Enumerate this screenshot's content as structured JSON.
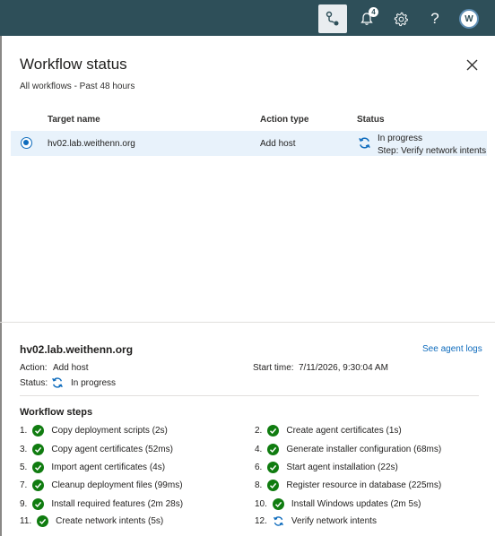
{
  "topbar": {
    "notification_count": "4",
    "avatar_initial": "W",
    "icons": [
      "workflow-icon",
      "bell-icon",
      "gear-icon",
      "help-icon",
      "avatar"
    ],
    "color": "#2e4f59"
  },
  "panel": {
    "title": "Workflow status",
    "subtitle": "All workflows - Past 48 hours"
  },
  "table": {
    "headers": {
      "target": "Target name",
      "action": "Action type",
      "status": "Status"
    },
    "rows": [
      {
        "target": "hv02.lab.weithenn.org",
        "action": "Add host",
        "status": "In progress",
        "step": "Step: Verify network intents",
        "selected": true
      }
    ]
  },
  "detail": {
    "host": "hv02.lab.weithenn.org",
    "see_logs": "See agent logs",
    "action_label": "Action:",
    "action_value": "Add host",
    "start_label": "Start time:",
    "start_value": "7/11/2026, 9:30:04 AM",
    "status_label": "Status:",
    "status_value": "In progress"
  },
  "steps": {
    "title": "Workflow steps",
    "items": [
      {
        "num": "1.",
        "label": "Copy deployment scripts (2s)",
        "state": "done"
      },
      {
        "num": "2.",
        "label": "Create agent certificates (1s)",
        "state": "done"
      },
      {
        "num": "3.",
        "label": "Copy agent certificates (52ms)",
        "state": "done"
      },
      {
        "num": "4.",
        "label": "Generate installer configuration (68ms)",
        "state": "done"
      },
      {
        "num": "5.",
        "label": "Import agent certificates (4s)",
        "state": "done"
      },
      {
        "num": "6.",
        "label": "Start agent installation (22s)",
        "state": "done"
      },
      {
        "num": "7.",
        "label": "Cleanup deployment files (99ms)",
        "state": "done"
      },
      {
        "num": "8.",
        "label": "Register resource in database (225ms)",
        "state": "done"
      },
      {
        "num": "9.",
        "label": "Install required features (2m 28s)",
        "state": "done"
      },
      {
        "num": "10.",
        "label": "Install Windows updates (2m 5s)",
        "state": "done"
      },
      {
        "num": "11.",
        "label": "Create network intents (5s)",
        "state": "done"
      },
      {
        "num": "12.",
        "label": "Verify network intents",
        "state": "in-progress"
      }
    ]
  },
  "colors": {
    "success": "#107c10",
    "progress": "#0f6cbd",
    "link": "#0f6cbd",
    "selected_row": "#e8f2fb"
  }
}
